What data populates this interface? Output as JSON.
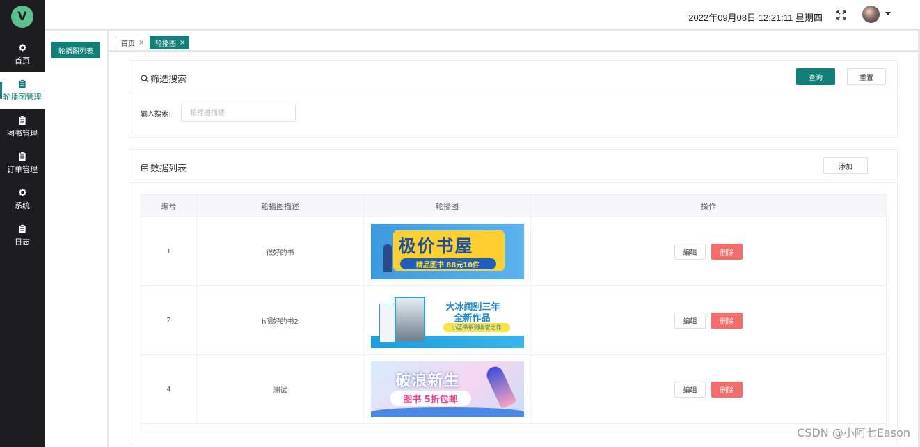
{
  "header": {
    "datetime": "2022年09月08日 12:21:11 星期四"
  },
  "nav": {
    "logo": "V",
    "items": [
      {
        "label": "首页",
        "icon": "gear-icon"
      },
      {
        "label": "轮播图管理",
        "icon": "clipboard-icon"
      },
      {
        "label": "图书管理",
        "icon": "clipboard-icon"
      },
      {
        "label": "订单管理",
        "icon": "clipboard-icon"
      },
      {
        "label": "系统",
        "icon": "gear-icon"
      },
      {
        "label": "日志",
        "icon": "clipboard-icon"
      }
    ]
  },
  "subnav": {
    "button_label": "轮播图列表"
  },
  "tabs": [
    {
      "label": "首页",
      "close": "×"
    },
    {
      "label": "轮播图",
      "close": "×"
    }
  ],
  "filter": {
    "title": "筛选搜索",
    "query_label": "查询",
    "reset_label": "重置",
    "field_label": "输入搜索:",
    "field_placeholder": "轮播图描述",
    "field_value": ""
  },
  "list": {
    "title": "数据列表",
    "add_label": "添加",
    "columns": [
      "编号",
      "轮播图描述",
      "轮播图",
      "操作"
    ],
    "edit_label": "编辑",
    "delete_label": "删除",
    "rows": [
      {
        "id": "1",
        "description": "很好的书",
        "banner": {
          "title": "极价书屋",
          "subtitle": "精品图书 88元10件"
        }
      },
      {
        "id": "2",
        "description": "h嗯好的书2",
        "banner": {
          "title": "大冰阔别三年",
          "title2": "全新作品",
          "tag": "小蓝书系列收官之作"
        }
      },
      {
        "id": "4",
        "description": "测试",
        "banner": {
          "title": "破浪新生",
          "subtitle": "图书 5折包邮"
        }
      }
    ]
  },
  "watermark": "CSDN @小阿七Eason",
  "colors": {
    "primary": "#127f78",
    "danger": "#f56c6c",
    "nav_bg": "#1d1d1f",
    "logo": "#5cc08f"
  }
}
